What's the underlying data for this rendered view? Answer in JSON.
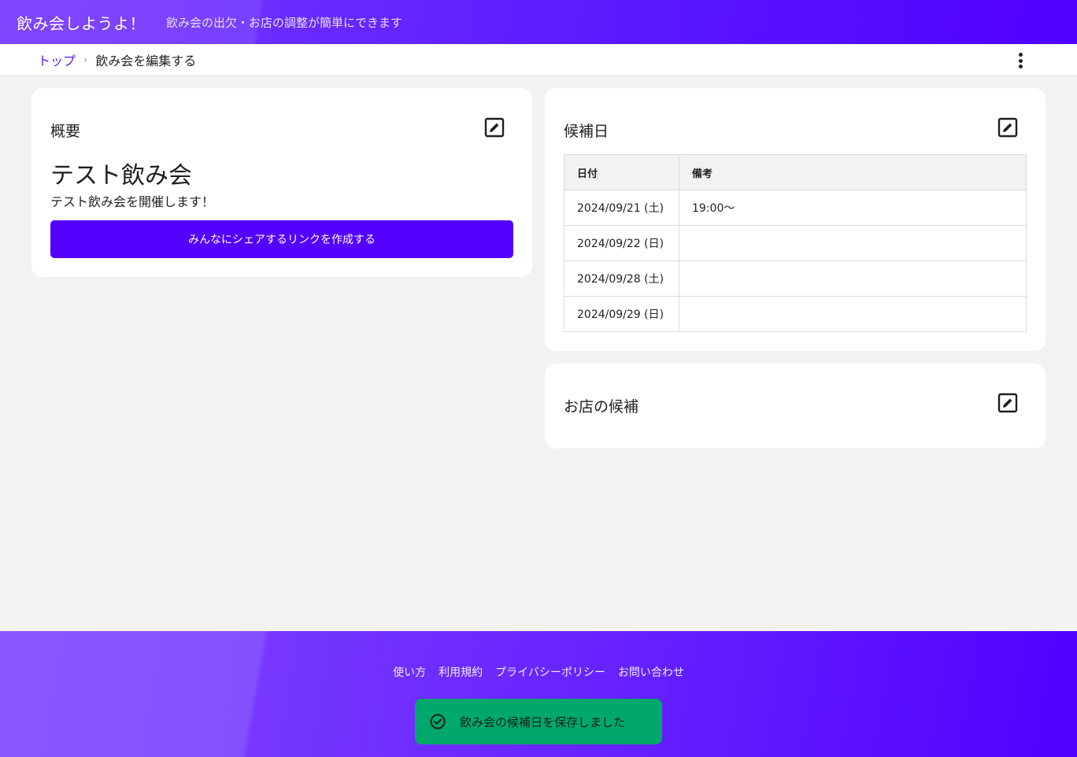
{
  "header": {
    "title": "飲み会しようよ！",
    "subtitle": "飲み会の出欠・お店の調整が簡単にできます"
  },
  "breadcrumb": {
    "top_label": "トップ",
    "current_label": "飲み会を編集する"
  },
  "icons": {
    "menu": "more-vertical-icon",
    "edit": "edit-square-icon",
    "chevron": "chevron-right-icon",
    "toast": "check-circle-icon"
  },
  "overview": {
    "title": "概要",
    "event_name": "テスト飲み会",
    "description": "テスト飲み会を開催します！",
    "share_button": "みんなにシェアするリンクを作成する"
  },
  "candidate_dates": {
    "title": "候補日",
    "columns": [
      "日付",
      "備考"
    ],
    "rows": [
      {
        "date": "2024/09/21 (土)",
        "note": "19:00～"
      },
      {
        "date": "2024/09/22 (日)",
        "note": ""
      },
      {
        "date": "2024/09/28 (土)",
        "note": ""
      },
      {
        "date": "2024/09/29 (日)",
        "note": ""
      }
    ]
  },
  "shops": {
    "title": "お店の候補"
  },
  "footer": {
    "links": [
      "使い方",
      "利用規約",
      "プライバシーポリシー",
      "お問い合わせ"
    ]
  },
  "toast": {
    "message": "飲み会の候補日を保存しました"
  },
  "colors": {
    "primary": "#5400ff",
    "toast": "#00a86b",
    "link": "#5a1cff"
  }
}
